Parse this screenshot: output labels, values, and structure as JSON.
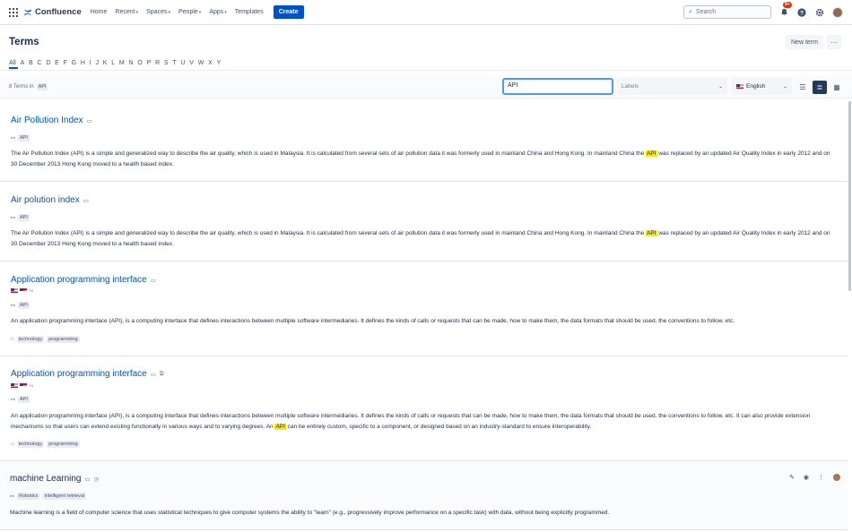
{
  "nav": {
    "brand": "Confluence",
    "items": [
      "Home",
      "Recent",
      "Spaces",
      "People",
      "Apps",
      "Templates"
    ],
    "create": "Create",
    "search_placeholder": "Search",
    "notif_badge": "9+"
  },
  "header": {
    "title": "Terms",
    "new_term": "New term",
    "more": "···"
  },
  "alphabet": [
    "All",
    "A",
    "B",
    "C",
    "D",
    "E",
    "F",
    "G",
    "H",
    "I",
    "J",
    "K",
    "L",
    "M",
    "N",
    "O",
    "P",
    "R",
    "S",
    "T",
    "U",
    "V",
    "W",
    "X",
    "Y"
  ],
  "filters": {
    "count_text": "8 Terms in",
    "space": "API",
    "query": "API",
    "labels_placeholder": "Labels",
    "language": "English"
  },
  "entries": [
    {
      "title": "Air Pollution Index",
      "related": [
        "API"
      ],
      "desc_before": "The Air Pollution Index (API) is a simple and generalized way to describe the air quality, which is used in Malaysia. It is calculated from several sets of air pollution data it was formerly used in mainland China and Hong Kong. In mainland China the ",
      "desc_hl": "API",
      "desc_after": " was replaced by an updated Air Quality Index in early 2012 and on 30 December 2013 Hong Kong moved to a health based index."
    },
    {
      "title": "Air polution index",
      "related": [
        "API"
      ],
      "desc_before": "The Air Pollution Index (API) is a simple and generalized way to describe the air quality, which is used in Malaysia. It is calculated from several sets of air pollution data it was formerly used in mainland China and Hong Kong. In mainland China the ",
      "desc_hl": "API",
      "desc_after": " was replaced by an updated Air Quality Index in early 2012 and on 30 December 2013 Hong Kong moved to a health based index."
    },
    {
      "title": "Application programming interface",
      "lang_extra": "+1",
      "related": [
        "API"
      ],
      "description": "An application programming intertace (API), is a computing intertace that defines interactions between multiple software intermediaries. It defines the kinds of calls or requests that can be made, how to make them, the data formats that should be used, the conventions to follow, etc.",
      "tags": [
        "technology",
        "programming"
      ]
    },
    {
      "title": "Application programming interface",
      "lang_extra": "+1",
      "related": [
        "API"
      ],
      "desc_before": "An application programming interface (API), is a computing interface that defines interactions between multiple software intermediaries. It defines the kinds of calls or requests that can be made, how to make them, the data formats that should be used, the conventions to follow, etc. It can also provide extension mechanisms so that users can extend existing functionally in various ways and to varying degrees. An ",
      "desc_hl": "API",
      "desc_after": " can be entirely custom, specific to a component, or designed based on an industry-standard to ensure interoperability.",
      "tags": [
        "technology",
        "programming"
      ]
    },
    {
      "title": "machine Learning",
      "related": [
        "Robotics",
        "Intelligent retrieval"
      ],
      "description": "Machine learning is a field of computer science that uses statistical techniques to give computer systems the ability to \"learn\" (e.g., progressively improve performance on a specific task) with data, without being explicitly programmed."
    }
  ],
  "icons": {
    "chev": "⌄",
    "link": "🔗",
    "tag": "⊘",
    "pencil": "✎",
    "eye": "◉",
    "kebab": "⋮"
  }
}
